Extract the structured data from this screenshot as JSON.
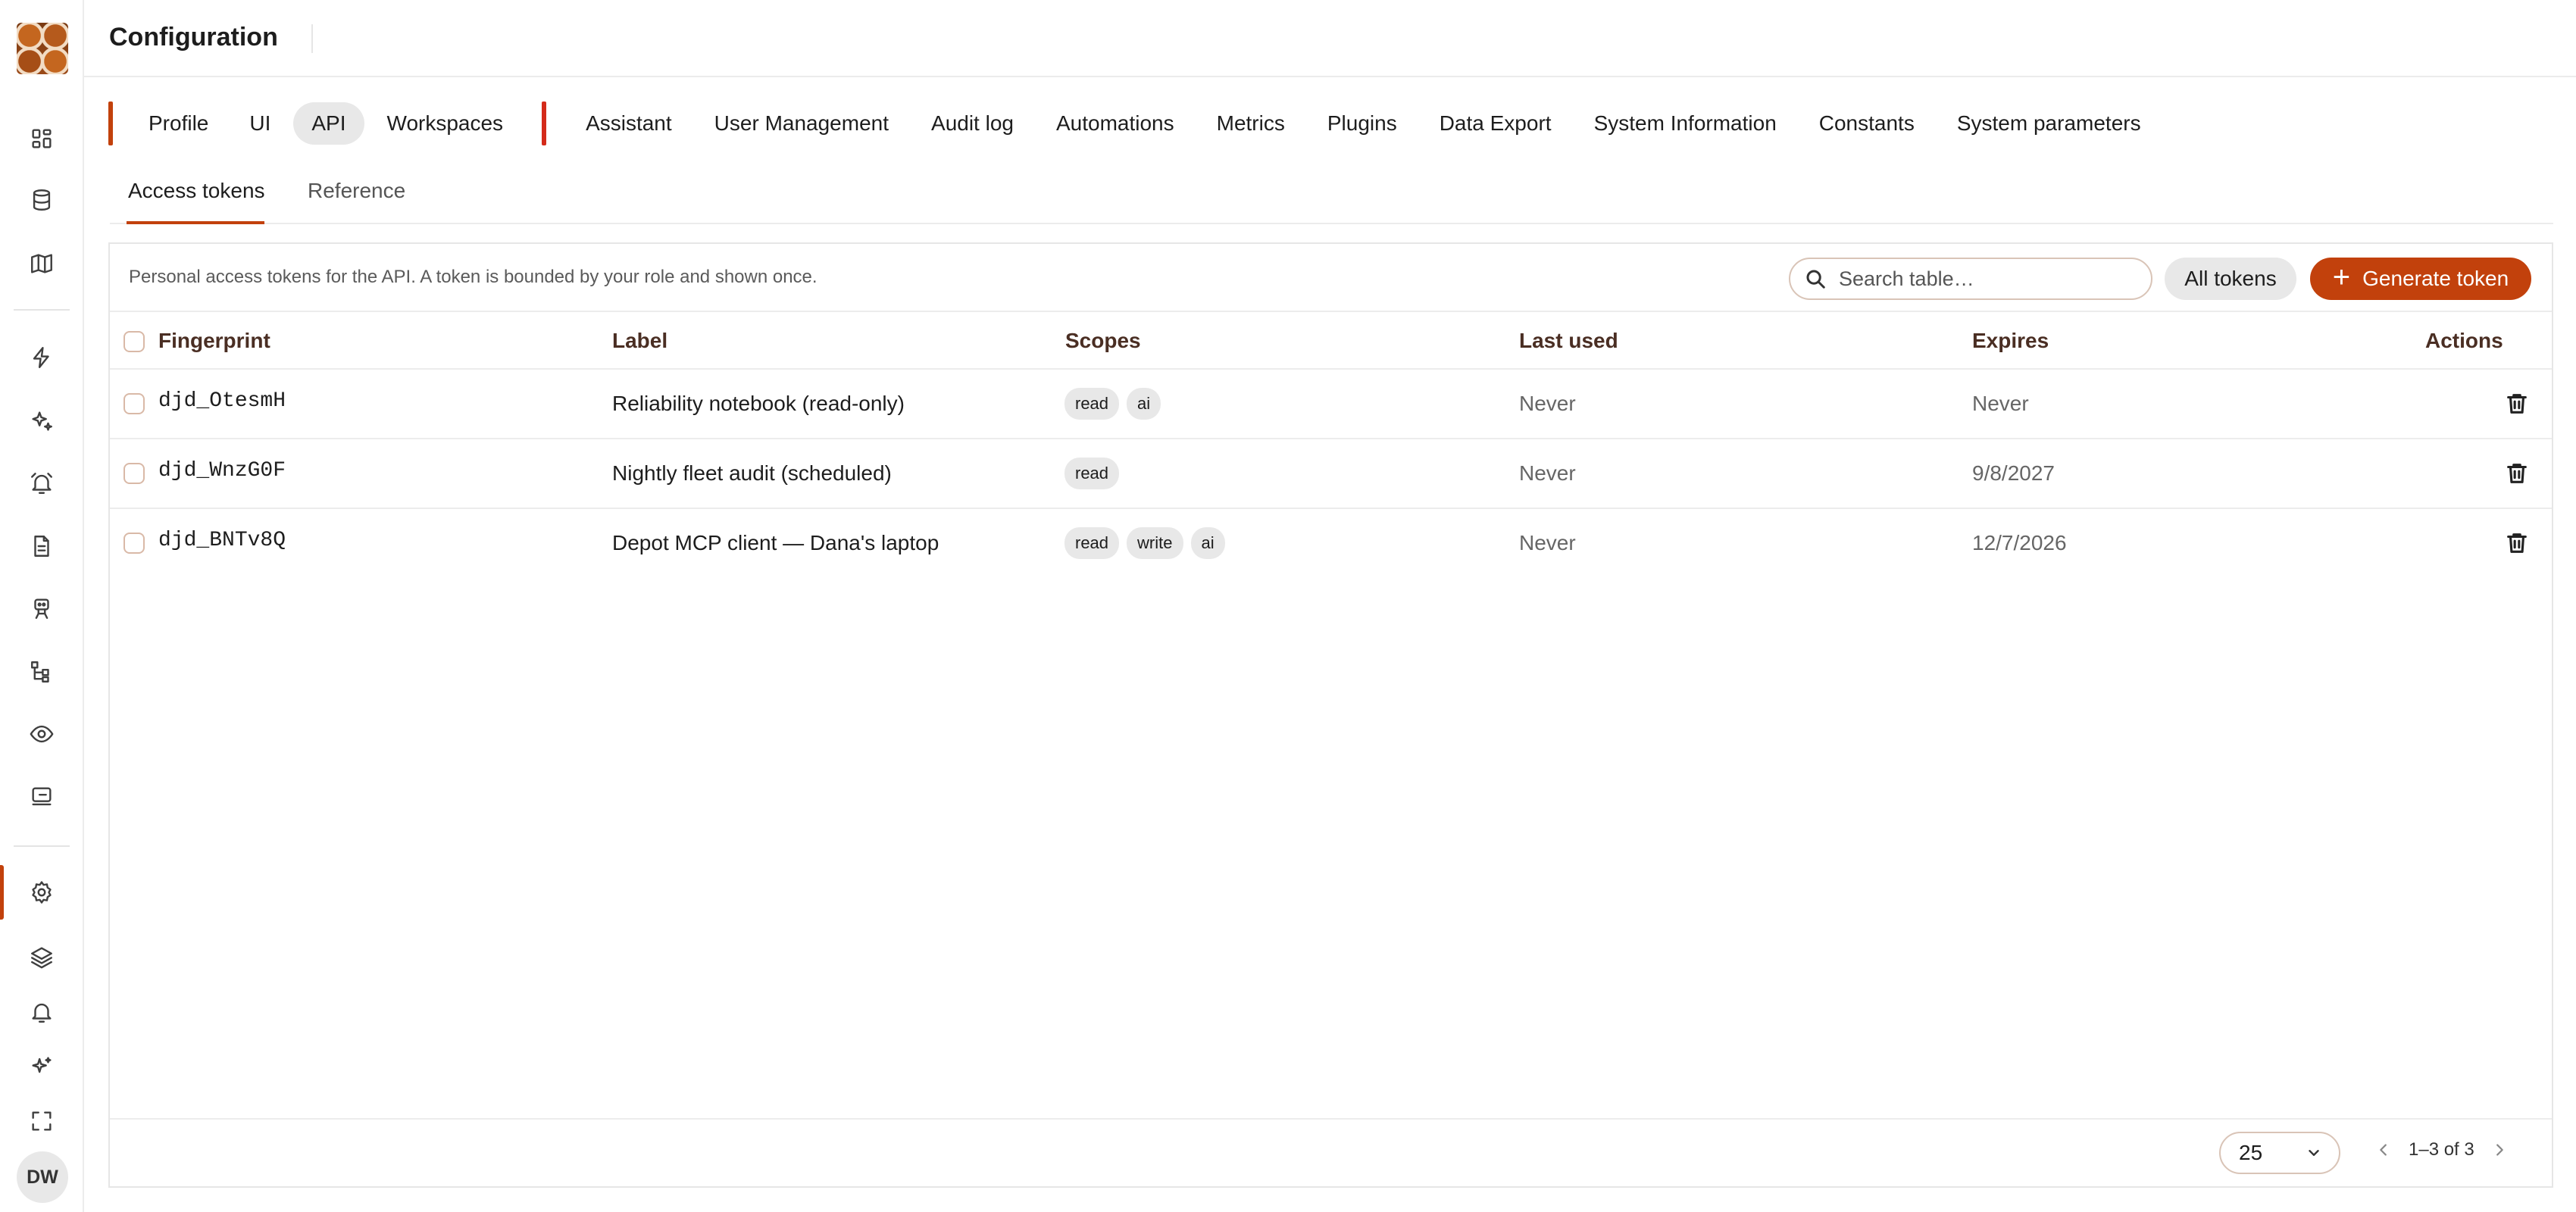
{
  "app": {
    "page_title": "Configuration",
    "avatar_initials": "DW",
    "accent_color": "#c2410c"
  },
  "sidebar": {
    "icons": [
      "dashboard-icon",
      "database-icon",
      "map-icon",
      "lightning-icon",
      "sparkles-icon",
      "alarm-icon",
      "document-icon",
      "robot-icon",
      "hierarchy-icon",
      "eye-icon",
      "monitor-icon",
      "gear-icon",
      "layers-icon",
      "bell-icon",
      "ai-sparkle-icon",
      "fullscreen-icon"
    ]
  },
  "top_tabs": {
    "group1": [
      "Profile",
      "UI",
      "API",
      "Workspaces"
    ],
    "group2": [
      "Assistant",
      "User Management",
      "Audit log",
      "Automations",
      "Metrics",
      "Plugins",
      "Data Export",
      "System Information",
      "Constants",
      "System parameters"
    ],
    "active": "API"
  },
  "sub_tabs": {
    "items": [
      "Access tokens",
      "Reference"
    ],
    "active": "Access tokens"
  },
  "toolbar": {
    "description": "Personal access tokens for the API. A token is bounded by your role and shown once.",
    "search_placeholder": "Search table…",
    "filter_label": "All tokens",
    "generate_label": "Generate token"
  },
  "table": {
    "columns": [
      "Fingerprint",
      "Label",
      "Scopes",
      "Last used",
      "Expires",
      "Actions"
    ],
    "rows": [
      {
        "fingerprint": "djd_OtesmH",
        "label": "Reliability notebook (read-only)",
        "scopes": [
          "read",
          "ai"
        ],
        "last_used": "Never",
        "expires": "Never"
      },
      {
        "fingerprint": "djd_WnzG0F",
        "label": "Nightly fleet audit (scheduled)",
        "scopes": [
          "read"
        ],
        "last_used": "Never",
        "expires": "9/8/2027"
      },
      {
        "fingerprint": "djd_BNTv8Q",
        "label": "Depot MCP client — Dana's laptop",
        "scopes": [
          "read",
          "write",
          "ai"
        ],
        "last_used": "Never",
        "expires": "12/7/2026"
      }
    ]
  },
  "footer": {
    "page_size": "25",
    "range": "1–3 of 3"
  }
}
